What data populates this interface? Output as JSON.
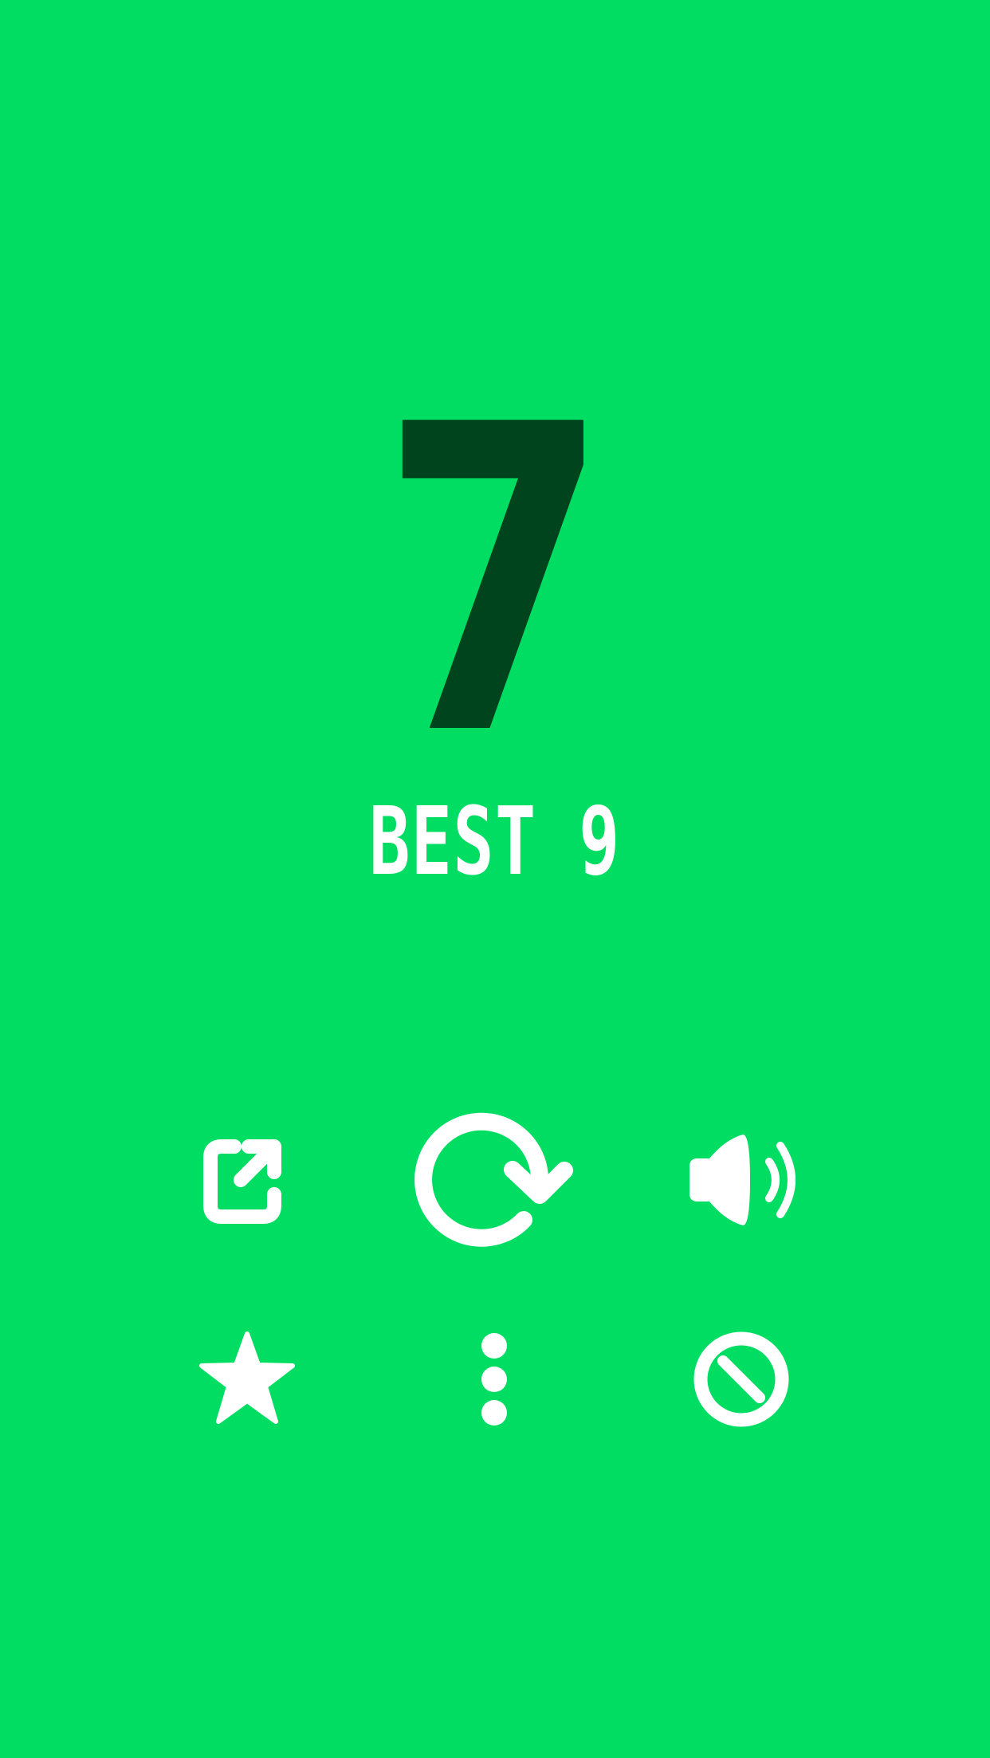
{
  "game": {
    "score": "7",
    "best_label": "BEST 9"
  },
  "colors": {
    "background": "#00DD63",
    "score": "#00441E",
    "icons": "#FFFFFF"
  },
  "controls": {
    "top_row": [
      "share-icon",
      "restart-icon",
      "sound-on-icon"
    ],
    "bottom_row": [
      "star-icon",
      "more-options-icon",
      "block-ads-icon"
    ]
  }
}
